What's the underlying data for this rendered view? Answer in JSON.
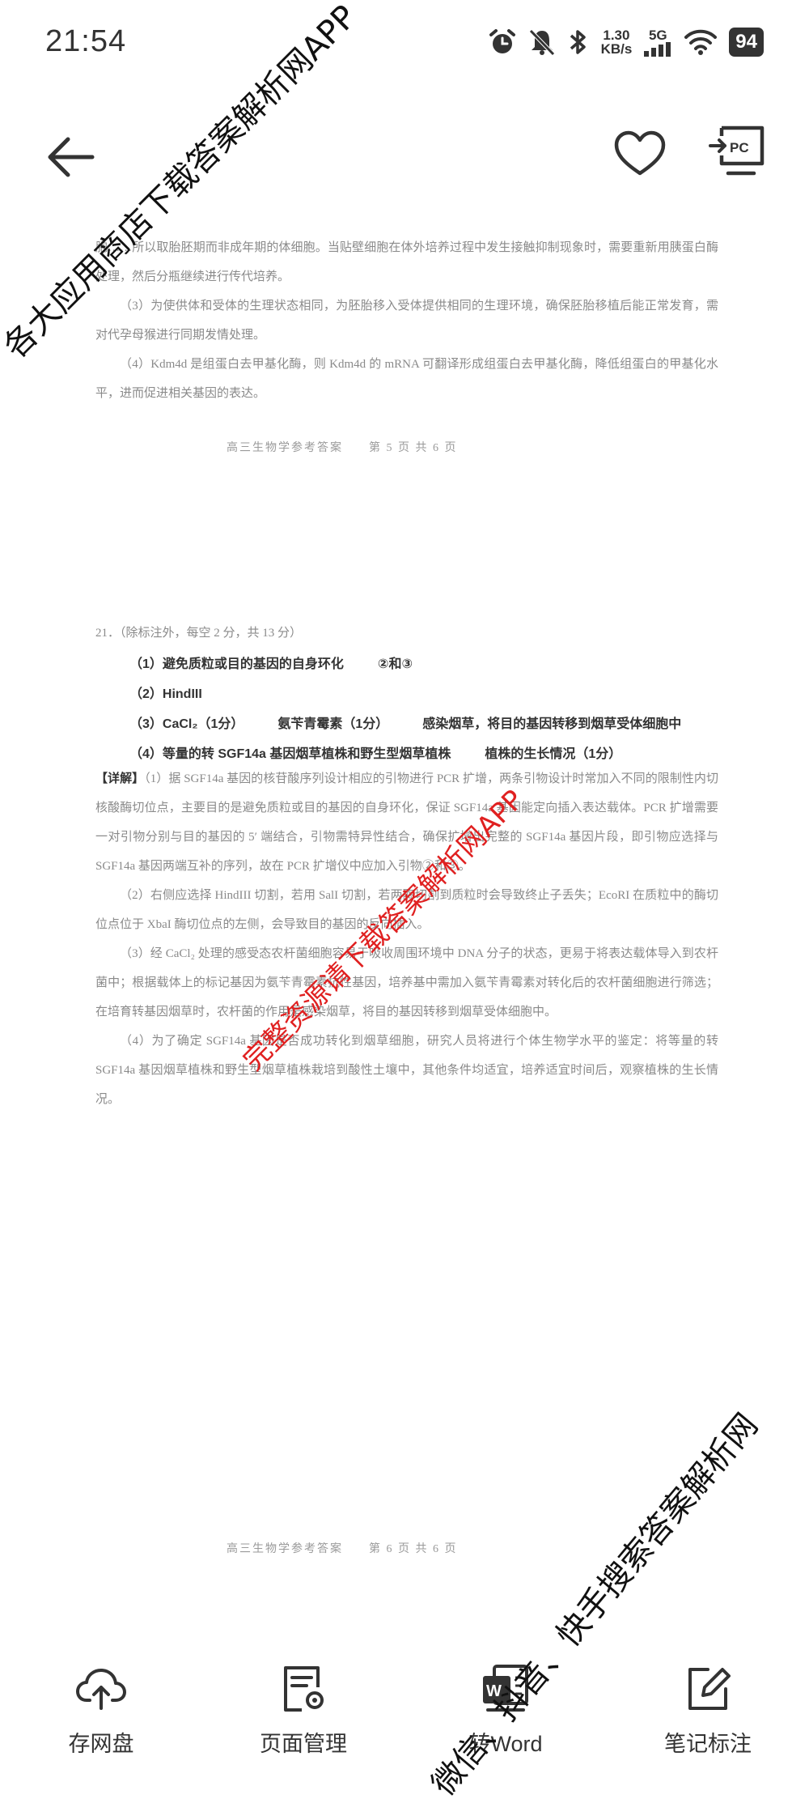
{
  "status_bar": {
    "time": "21:54",
    "net_speed_value": "1.30",
    "net_speed_unit": "KB/s",
    "network": "5G",
    "battery": "94"
  },
  "document": {
    "p1": "胞……所以取胎胚期而非成年期的体细胞。当贴壁细胞在体外培养过程中发生接触抑制现象时，需要重新用胰蛋白酶处理，然后分瓶继续进行传代培养。",
    "p2": "（3）为使供体和受体的生理状态相同，为胚胎移入受体提供相同的生理环境，确保胚胎移植后能正常发育，需对代孕母猴进行同期发情处理。",
    "p3": "（4）Kdm4d 是组蛋白去甲基化酶，则 Kdm4d 的 mRNA 可翻译形成组蛋白去甲基化酶，降低组蛋白的甲基化水平，进而促进相关基因的表达。",
    "footer1": "高三生物学参考答案　　第 5 页 共 6 页",
    "q21_head": "21．（除标注外，每空 2 分，共 13 分）",
    "a1": "（1）避免质粒或目的基因的自身环化",
    "a1b": "②和③",
    "a2": "（2）HindIII",
    "a3": "（3）CaCl₂（1分）",
    "a3b": "氨苄青霉素（1分）",
    "a3c": "感染烟草，将目的基因转移到烟草受体细胞中",
    "a4": "（4）等量的转 SGF14a 基因烟草植株和野生型烟草植株",
    "a4b": "植株的生长情况（1分）",
    "detail_mark": "【详解】",
    "d1": "（1）据 SGF14a 基因的核苷酸序列设计相应的引物进行 PCR 扩增，两条引物设计时常加入不同的限制性内切核酸酶切位点，主要目的是避免质粒或目的基因的自身环化，保证 SGF14a 基因能定向插入表达载体。PCR 扩增需要一对引物分别与目的基因的 5′ 端结合，引物需特异性结合，确保扩增出完整的 SGF14a 基因片段，即引物应选择与 SGF14a 基因两端互补的序列，故在 PCR 扩增仪中应加入引物②和③。",
    "d2": "（2）右侧应选择 HindIII 切割，若用 SalI 切割，若两酶切割到质粒时会导致终止子丢失；EcoRI 在质粒中的酶切位点位于 XbaI 酶切位点的左侧，会导致目的基因的反向插入。",
    "d3": "（3）经 CaCl₂ 处理的感受态农杆菌细胞容易于吸收周围环境中 DNA 分子的状态，更易于将表达载体导入到农杆菌中；根据载体上的标记基因为氨苄青霉素抗性基因，培养基中需加入氨苄青霉素对转化后的农杆菌细胞进行筛选；在培育转基因烟草时，农杆菌的作用是感染烟草，将目的基因转移到烟草受体细胞中。",
    "d4": "（4）为了确定 SGF14a 基因是否成功转化到烟草细胞，研究人员将进行个体生物学水平的鉴定：将等量的转 SGF14a 基因烟草植株和野生型烟草植株栽培到酸性土壤中，其他条件均适宜，培养适宜时间后，观察植株的生长情况。",
    "footer2": "高三生物学参考答案　　第 6 页 共 6 页"
  },
  "watermarks": {
    "top": "各大应用商店下载答案解析网APP",
    "middle": "完整资源请下载答案解析网APP",
    "bottom": "微信、抖音、快手搜索答案解析网"
  },
  "toolbar": {
    "items": [
      {
        "label": "存网盘",
        "icon": "cloud-upload-icon"
      },
      {
        "label": "页面管理",
        "icon": "page-settings-icon"
      },
      {
        "label": "转Word",
        "icon": "word-convert-icon"
      },
      {
        "label": "笔记标注",
        "icon": "edit-note-icon"
      }
    ]
  },
  "colors": {
    "watermark_red": "#e02020",
    "icon_dark": "#333333",
    "doc_text": "#8a8a8a"
  }
}
